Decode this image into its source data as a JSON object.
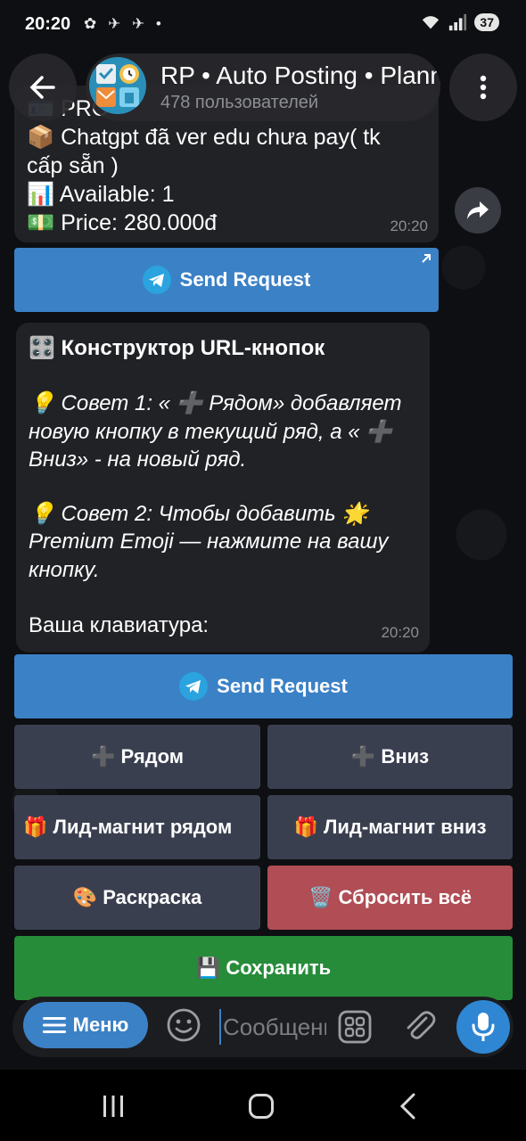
{
  "status_bar": {
    "time": "20:20",
    "app_icons": "✿ ✈ ✈ •",
    "battery": "37"
  },
  "header": {
    "title": "RP • Auto Posting • Planner",
    "subtitle": "478 пользователей"
  },
  "message1": {
    "line0": "🪪 PRO",
    "line1": "📦 Chatgpt đã ver edu chưa pay( tk",
    "line2": "cấp sẵn )",
    "line3": "📊 Available: 1",
    "line4": "💵 Price: 280.000đ",
    "time": "20:20",
    "button": "Send Request"
  },
  "message2": {
    "title": "🎛️ Конструктор URL-кнопок",
    "tip1_line1": "💡 Совет 1: « ➕ Рядом» добавляет",
    "tip1_line2": "новую кнопку в текущий ряд, а « ➕",
    "tip1_line3": "Вниз» - на новый ряд.",
    "tip2_line1": "💡 Совет 2: Чтобы добавить 🌟",
    "tip2_line2": "Premium Emoji — нажмите на вашу",
    "tip2_line3": "кнопку.",
    "keyboard_label": "Ваша клавиатура:",
    "time": "20:20"
  },
  "keyboard": {
    "send_request": "Send Request",
    "add_side": "➕ Рядом",
    "add_down": "➕ Вниз",
    "lead_side": "🎁 Лид-магнит рядом",
    "lead_down": "🎁 Лид-магнит вниз",
    "coloring": "🎨 Раскраска",
    "reset_all": "🗑️ Сбросить всё",
    "save": "💾 Сохранить"
  },
  "compose": {
    "menu_label": "Меню",
    "placeholder": "Сообщение"
  },
  "colors": {
    "accent_blue": "#3b81c6",
    "bubble": "#212226",
    "slate_button": "#3a3f50",
    "red_button": "#b04d55",
    "green_button": "#278c3a"
  }
}
